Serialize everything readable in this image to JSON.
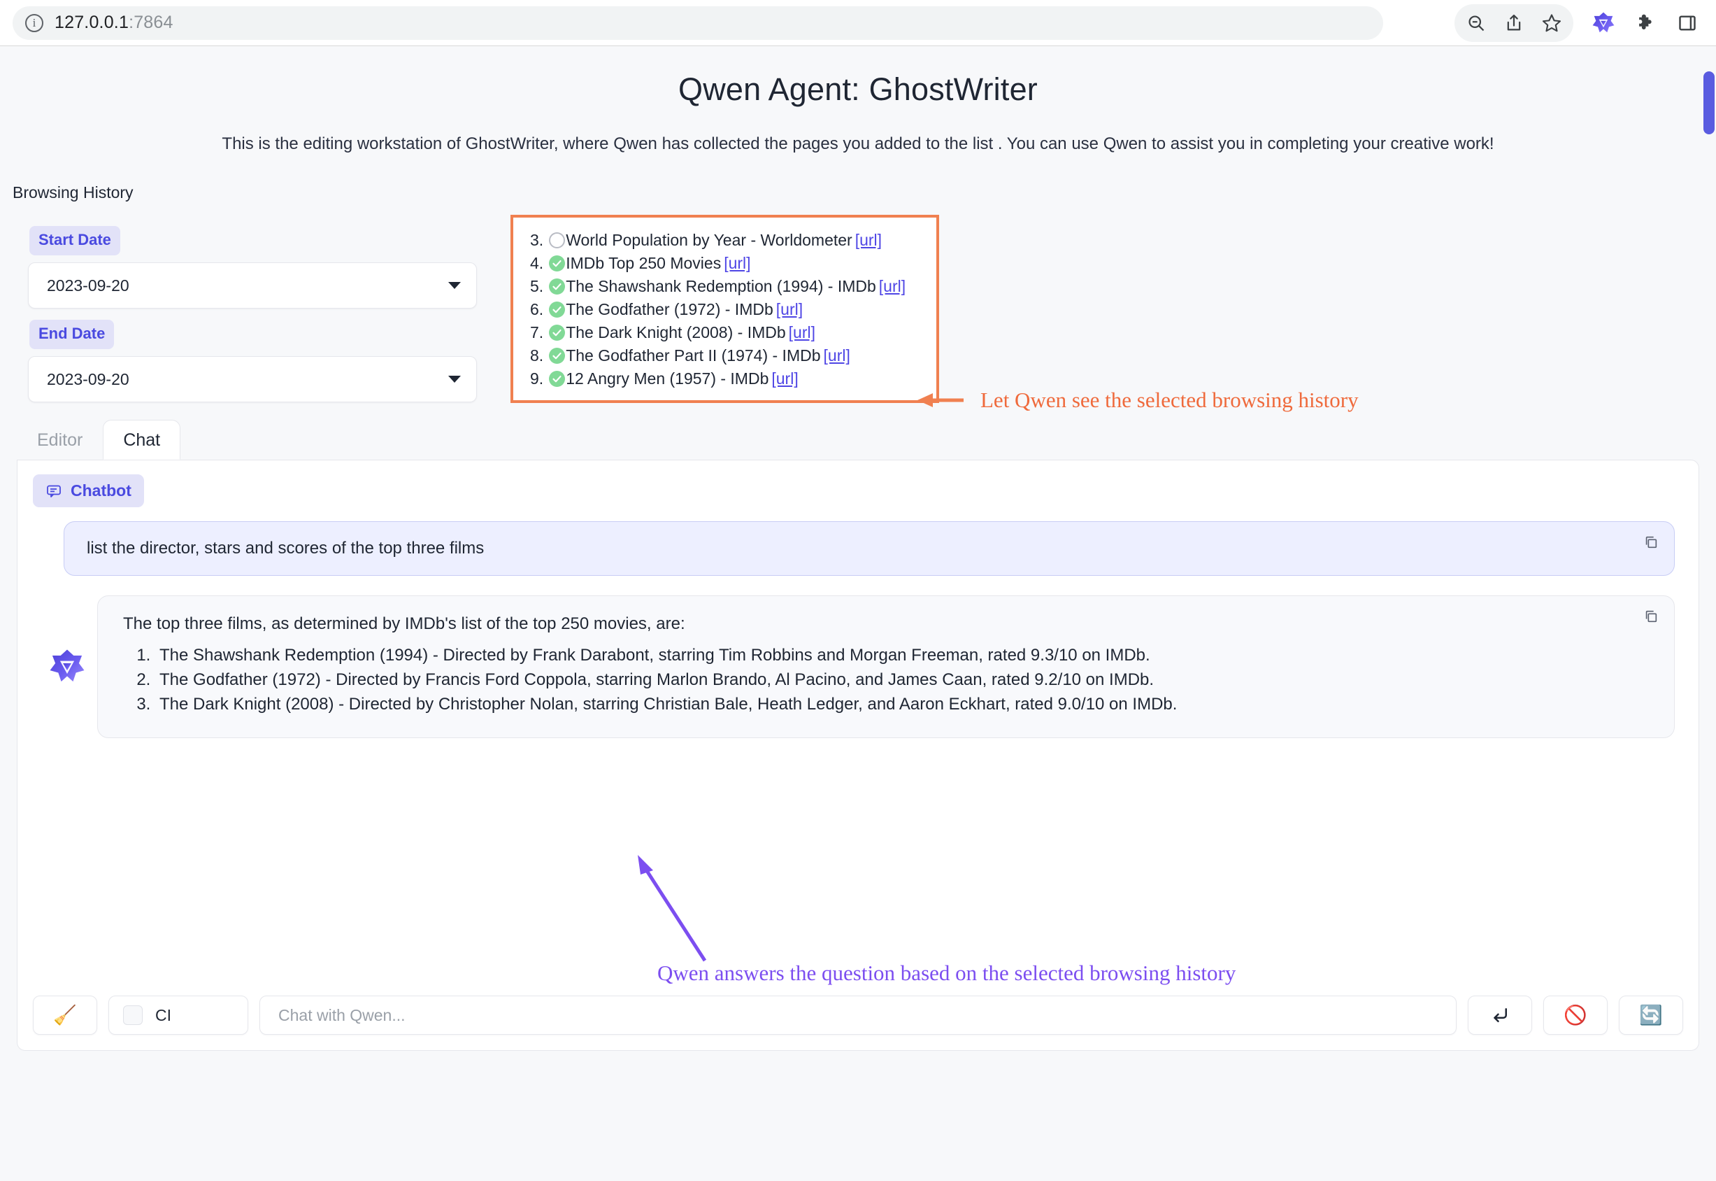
{
  "browser": {
    "url_host": "127.0.0.1",
    "url_port": ":7864",
    "info_glyph": "i",
    "actions": [
      {
        "name": "zoom-out-icon",
        "label": "Zoom out"
      },
      {
        "name": "share-icon",
        "label": "Share"
      },
      {
        "name": "bookmark-star-icon",
        "label": "Bookmark"
      },
      {
        "name": "qwen-extension-icon",
        "label": "Qwen Agent extension"
      },
      {
        "name": "extensions-puzzle-icon",
        "label": "Extensions"
      },
      {
        "name": "sidebar-toggle-icon",
        "label": "Toggle sidebar"
      }
    ]
  },
  "app": {
    "title": "Qwen Agent: GhostWriter",
    "description": "This is the editing workstation of GhostWriter, where Qwen has collected the pages you added to the list . You can use Qwen to assist you in completing your creative work!",
    "section_label": "Browsing History"
  },
  "filters": {
    "start_date_label": "Start Date",
    "start_date_value": "2023-09-20",
    "end_date_label": "End Date",
    "end_date_value": "2023-09-20"
  },
  "history": {
    "items": [
      {
        "index": "3.",
        "checked": false,
        "title": "World Population by Year - Worldometer",
        "url_label": "[url]"
      },
      {
        "index": "4.",
        "checked": true,
        "title": "IMDb Top 250 Movies",
        "url_label": "[url]"
      },
      {
        "index": "5.",
        "checked": true,
        "title": "The Shawshank Redemption (1994) - IMDb",
        "url_label": "[url]"
      },
      {
        "index": "6.",
        "checked": true,
        "title": "The Godfather (1972) - IMDb",
        "url_label": "[url]"
      },
      {
        "index": "7.",
        "checked": true,
        "title": "The Dark Knight (2008) - IMDb",
        "url_label": "[url]"
      },
      {
        "index": "8.",
        "checked": true,
        "title": "The Godfather Part II (1974) - IMDb",
        "url_label": "[url]"
      },
      {
        "index": "9.",
        "checked": true,
        "title": "12 Angry Men (1957) - IMDb",
        "url_label": "[url]"
      }
    ]
  },
  "annotations": {
    "orange_text": "Let Qwen see the selected browsing history",
    "orange_color": "#ef6a3c",
    "purple_text": "Qwen answers the question based on the selected browsing history",
    "purple_color": "#7c4ef0"
  },
  "tabs": [
    {
      "label": "Editor",
      "active": false
    },
    {
      "label": "Chat",
      "active": true
    }
  ],
  "chat": {
    "panel_label": "Chatbot",
    "user_message": "list the director, stars and scores of the top three films",
    "bot_intro": "The top three films, as determined by IMDb's list of the top 250 movies, are:",
    "bot_items": [
      "The Shawshank Redemption (1994) - Directed by Frank Darabont, starring Tim Robbins and Morgan Freeman, rated 9.3/10 on IMDb.",
      "The Godfather (1972) - Directed by Francis Ford Coppola, starring Marlon Brando, Al Pacino, and James Caan, rated 9.2/10 on IMDb.",
      "The Dark Knight (2008) - Directed by Christopher Nolan, starring Christian Bale, Heath Ledger, and Aaron Eckhart, rated 9.0/10 on IMDb."
    ]
  },
  "toolbar": {
    "clear_icon": "🧹",
    "ci_label": "CI",
    "input_placeholder": "Chat with Qwen...",
    "submit_icon": "↵",
    "stop_icon": "🚫",
    "retry_icon": "🔄"
  },
  "colors": {
    "accent": "#4a4ae0",
    "highlight_box": "#f08050",
    "check_green": "#81d996",
    "page_bg": "#f7f8fa"
  }
}
